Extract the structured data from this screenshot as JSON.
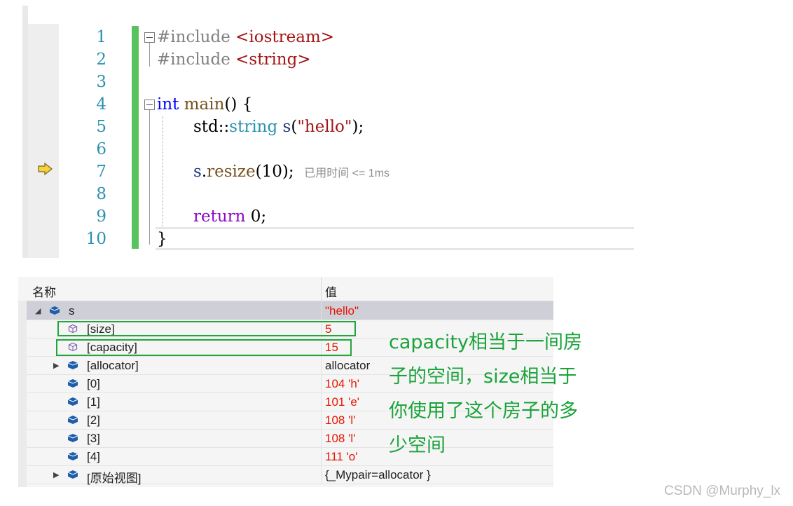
{
  "editor": {
    "line_numbers": [
      "1",
      "2",
      "3",
      "4",
      "5",
      "6",
      "7",
      "8",
      "9",
      "10"
    ],
    "lines": {
      "l1": {
        "kw": "#include",
        "arg": "<iostream>"
      },
      "l2": {
        "kw": "#include",
        "arg": "<string>"
      },
      "l4": {
        "type": "int",
        "name": "main",
        "rest": "() {"
      },
      "l5": {
        "ns": "std::",
        "cls": "string",
        "var": "s",
        "open": "(",
        "str": "\"hello\"",
        "close": ");"
      },
      "l7": {
        "var": "s",
        "dot": ".",
        "fn": "resize",
        "args": "(10);"
      },
      "l9": {
        "kw": "return",
        "rest": " 0;"
      },
      "l10": {
        "brace": "}"
      }
    },
    "elapsed_hint": "已用时间 <= 1ms",
    "current_statement_icon": "execution-arrow-icon",
    "colors": {
      "change_bar": "#58c35c",
      "line_number": "#2b91af",
      "keyword": "#0000ff",
      "control": "#8f08c4",
      "string": "#a31515"
    }
  },
  "watch": {
    "columns": {
      "name": "名称",
      "value": "值"
    },
    "rows": [
      {
        "name": "s",
        "value": "\"hello\"",
        "icon": "object-icon"
      },
      {
        "name": "[size]",
        "value": "5",
        "icon": "property-icon"
      },
      {
        "name": "[capacity]",
        "value": "15",
        "icon": "property-icon"
      },
      {
        "name": "[allocator]",
        "value": "allocator",
        "icon": "object-icon"
      },
      {
        "name": "[0]",
        "value": "104 'h'",
        "icon": "object-icon"
      },
      {
        "name": "[1]",
        "value": "101 'e'",
        "icon": "object-icon"
      },
      {
        "name": "[2]",
        "value": "108 'l'",
        "icon": "object-icon"
      },
      {
        "name": "[3]",
        "value": "108 'l'",
        "icon": "object-icon"
      },
      {
        "name": "[4]",
        "value": "111 'o'",
        "icon": "object-icon"
      },
      {
        "name": "[原始视图]",
        "value": "{_Mypair=allocator }",
        "icon": "object-icon"
      }
    ],
    "colors": {
      "changed_value": "#e51400",
      "highlight_box": "#22a63a"
    }
  },
  "annotation": {
    "lines": [
      "capacity相当于一间房",
      "子的空间，size相当于",
      "你使用了这个房子的多",
      "少空间"
    ],
    "color": "#1aa33a"
  },
  "watermark": "CSDN @Murphy_lx"
}
